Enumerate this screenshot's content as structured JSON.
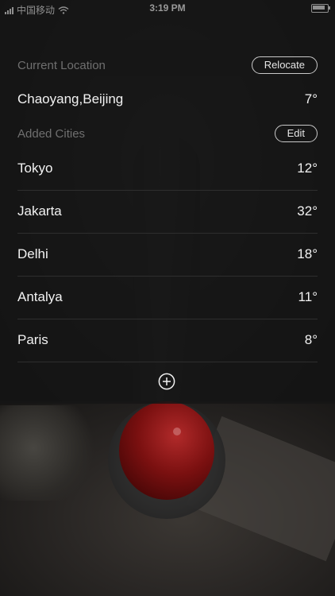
{
  "status_bar": {
    "carrier": "中国移动",
    "time": "3:19 PM"
  },
  "current_location": {
    "section_title": "Current Location",
    "relocate_label": "Relocate",
    "city": "Chaoyang,Beijing",
    "temp": "7°"
  },
  "added_cities": {
    "section_title": "Added Cities",
    "edit_label": "Edit",
    "items": [
      {
        "city": "Tokyo",
        "temp": "12°"
      },
      {
        "city": "Jakarta",
        "temp": "32°"
      },
      {
        "city": "Delhi",
        "temp": "18°"
      },
      {
        "city": "Antalya",
        "temp": "11°"
      },
      {
        "city": "Paris",
        "temp": "8°"
      }
    ]
  },
  "icons": {
    "add": "plus-circle-icon",
    "wifi": "wifi-icon",
    "battery": "battery-icon",
    "signal": "signal-icon"
  },
  "colors": {
    "panel_bg": "#161616",
    "text_primary": "#f2f2f2",
    "text_muted": "#6f6f6f",
    "divider": "#2e2e2e",
    "thermometer_red": "#7a1010"
  }
}
